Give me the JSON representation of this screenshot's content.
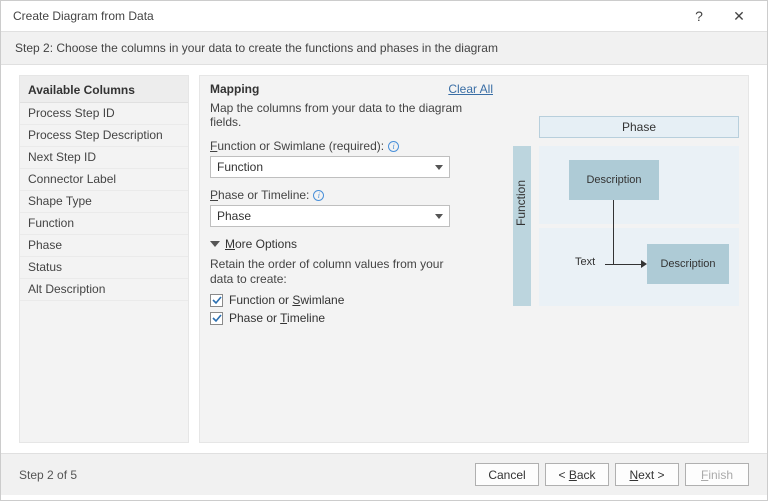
{
  "window": {
    "title": "Create Diagram from Data",
    "help_glyph": "?",
    "close_glyph": "✕"
  },
  "step_description": "Step 2: Choose the columns in your data to create the functions and phases in the diagram",
  "available_columns": {
    "header": "Available Columns",
    "items": [
      "Process Step ID",
      "Process Step Description",
      "Next Step ID",
      "Connector Label",
      "Shape Type",
      "Function",
      "Phase",
      "Status",
      "Alt Description"
    ]
  },
  "mapping": {
    "header": "Mapping",
    "clear_all": "Clear All",
    "intro": "Map the columns from your data to the diagram fields.",
    "function_label_pre": "F",
    "function_label_rest": "unction or Swimlane (required):",
    "function_value": "Function",
    "phase_label_pre": "P",
    "phase_label_rest": "hase or Timeline:",
    "phase_value": "Phase",
    "more_pre": "M",
    "more_rest": "ore Options",
    "retain": "Retain the order of column values from your data to create:",
    "chk_func_pre": "Function or ",
    "chk_func_u": "S",
    "chk_func_rest": "wimlane",
    "chk_phase_pre": "Phase or ",
    "chk_phase_u": "T",
    "chk_phase_rest": "imeline"
  },
  "preview": {
    "phase": "Phase",
    "function": "Function",
    "desc": "Description",
    "text": "Text"
  },
  "footer": {
    "step_count": "Step 2 of 5",
    "cancel": "Cancel",
    "back_pre": "< ",
    "back_u": "B",
    "back_rest": "ack",
    "next_u": "N",
    "next_rest": "ext >",
    "finish_u": "F",
    "finish_rest": "inish"
  }
}
